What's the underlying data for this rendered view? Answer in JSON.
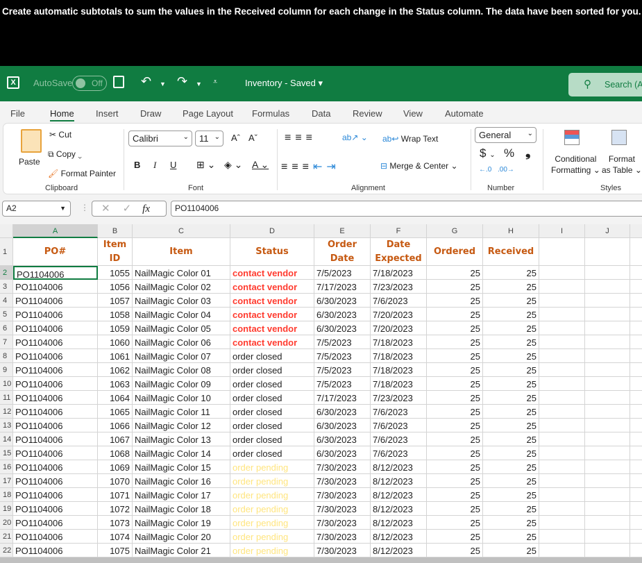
{
  "instruction": {
    "pre": "Create automatic subtotals to sum the values in the ",
    "b1": "Received",
    "mid": " column for each change in the ",
    "b2": "Status",
    "post": " column. The data have been sorted for you."
  },
  "titlebar": {
    "autosave": "AutoSave",
    "toggle": "Off",
    "doc_title": "Inventory - Saved",
    "search": "Search (Al"
  },
  "tabs": [
    "File",
    "Home",
    "Insert",
    "Draw",
    "Page Layout",
    "Formulas",
    "Data",
    "Review",
    "View",
    "Automate"
  ],
  "active_tab": "Home",
  "ribbon": {
    "paste": "Paste",
    "cut": "Cut",
    "copy": "Copy",
    "format_painter": "Format Painter",
    "clipboard": "Clipboard",
    "font_name": "Calibri",
    "font_size": "11",
    "font": "Font",
    "bold": "B",
    "italic": "I",
    "underline": "U",
    "wrap_text": "Wrap Text",
    "merge_center": "Merge & Center",
    "alignment": "Alignment",
    "number_format": "General",
    "currency": "$",
    "percent": "%",
    "comma": "❟",
    "number": "Number",
    "cond_fmt1": "Conditional",
    "cond_fmt2": "Formatting",
    "fmt_table1": "Format",
    "fmt_table2": "as Table",
    "styles": "Styles"
  },
  "formula_bar": {
    "name_box": "A2",
    "fx": "fx",
    "value": "PO1104006"
  },
  "columns": [
    "A",
    "B",
    "C",
    "D",
    "E",
    "F",
    "G",
    "H",
    "I",
    "J"
  ],
  "headers": [
    "PO#",
    "Item ID",
    "Item",
    "Status",
    "Order Date",
    "Date Expected",
    "Ordered",
    "Received"
  ],
  "status_colors": {
    "contact vendor": "#ff3b2f",
    "order closed": "#222222",
    "order pending": "#ffe57f"
  },
  "accent": "#107c41",
  "rows": [
    [
      "PO1104006",
      "1055",
      "NailMagic Color 01",
      "contact vendor",
      "7/5/2023",
      "7/18/2023",
      "25",
      "25"
    ],
    [
      "PO1104006",
      "1056",
      "NailMagic Color 02",
      "contact vendor",
      "7/17/2023",
      "7/23/2023",
      "25",
      "25"
    ],
    [
      "PO1104006",
      "1057",
      "NailMagic Color 03",
      "contact vendor",
      "6/30/2023",
      "7/6/2023",
      "25",
      "25"
    ],
    [
      "PO1104006",
      "1058",
      "NailMagic Color 04",
      "contact vendor",
      "6/30/2023",
      "7/20/2023",
      "25",
      "25"
    ],
    [
      "PO1104006",
      "1059",
      "NailMagic Color 05",
      "contact vendor",
      "6/30/2023",
      "7/20/2023",
      "25",
      "25"
    ],
    [
      "PO1104006",
      "1060",
      "NailMagic Color 06",
      "contact vendor",
      "7/5/2023",
      "7/18/2023",
      "25",
      "25"
    ],
    [
      "PO1104006",
      "1061",
      "NailMagic Color 07",
      "order closed",
      "7/5/2023",
      "7/18/2023",
      "25",
      "25"
    ],
    [
      "PO1104006",
      "1062",
      "NailMagic Color 08",
      "order closed",
      "7/5/2023",
      "7/18/2023",
      "25",
      "25"
    ],
    [
      "PO1104006",
      "1063",
      "NailMagic Color 09",
      "order closed",
      "7/5/2023",
      "7/18/2023",
      "25",
      "25"
    ],
    [
      "PO1104006",
      "1064",
      "NailMagic Color 10",
      "order closed",
      "7/17/2023",
      "7/23/2023",
      "25",
      "25"
    ],
    [
      "PO1104006",
      "1065",
      "NailMagic Color 11",
      "order closed",
      "6/30/2023",
      "7/6/2023",
      "25",
      "25"
    ],
    [
      "PO1104006",
      "1066",
      "NailMagic Color 12",
      "order closed",
      "6/30/2023",
      "7/6/2023",
      "25",
      "25"
    ],
    [
      "PO1104006",
      "1067",
      "NailMagic Color 13",
      "order closed",
      "6/30/2023",
      "7/6/2023",
      "25",
      "25"
    ],
    [
      "PO1104006",
      "1068",
      "NailMagic Color 14",
      "order closed",
      "6/30/2023",
      "7/6/2023",
      "25",
      "25"
    ],
    [
      "PO1104006",
      "1069",
      "NailMagic Color 15",
      "order pending",
      "7/30/2023",
      "8/12/2023",
      "25",
      "25"
    ],
    [
      "PO1104006",
      "1070",
      "NailMagic Color 16",
      "order pending",
      "7/30/2023",
      "8/12/2023",
      "25",
      "25"
    ],
    [
      "PO1104006",
      "1071",
      "NailMagic Color 17",
      "order pending",
      "7/30/2023",
      "8/12/2023",
      "25",
      "25"
    ],
    [
      "PO1104006",
      "1072",
      "NailMagic Color 18",
      "order pending",
      "7/30/2023",
      "8/12/2023",
      "25",
      "25"
    ],
    [
      "PO1104006",
      "1073",
      "NailMagic Color 19",
      "order pending",
      "7/30/2023",
      "8/12/2023",
      "25",
      "25"
    ],
    [
      "PO1104006",
      "1074",
      "NailMagic Color 20",
      "order pending",
      "7/30/2023",
      "8/12/2023",
      "25",
      "25"
    ],
    [
      "PO1104006",
      "1075",
      "NailMagic Color 21",
      "order pending",
      "7/30/2023",
      "8/12/2023",
      "25",
      "25"
    ]
  ]
}
